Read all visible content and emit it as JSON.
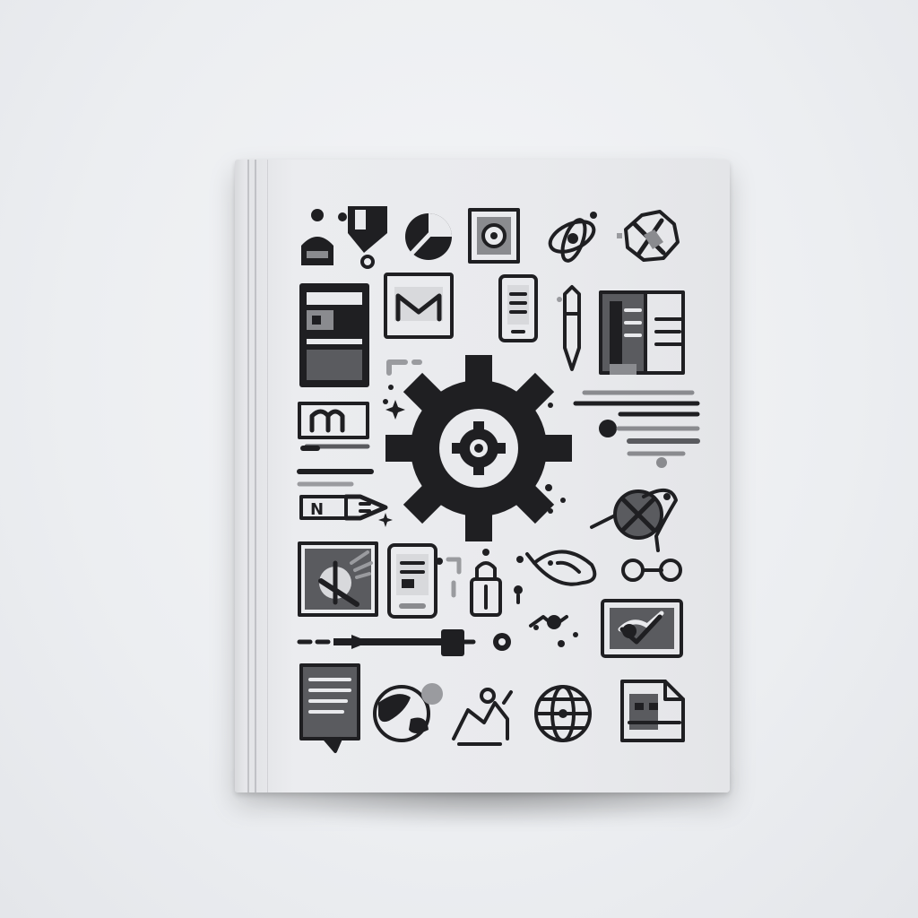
{
  "scene": {
    "background_color": "#eceef1",
    "book_color": "#e9eaed",
    "ink_dark": "#1f1f22",
    "ink_mid": "#5a5b5f",
    "ink_light": "#9a9b9f"
  },
  "cover": {
    "glyph_letter_n": "N",
    "icons": [
      "person-icon",
      "printer-icon",
      "pie-chart-icon",
      "photo-frame-icon",
      "atom-icon",
      "flower-icon",
      "browser-window-icon",
      "envelope-icon",
      "phone-icon",
      "pencil-icon",
      "open-book-icon",
      "gear-icon",
      "text-lines-icon",
      "magnet-icon",
      "pen-icon",
      "target-icon",
      "tablet-icon",
      "lock-icon",
      "fish-icon",
      "network-icon",
      "slider-icon",
      "video-icon",
      "document-icon",
      "globe-icon",
      "drawing-icon",
      "file-icon"
    ]
  }
}
